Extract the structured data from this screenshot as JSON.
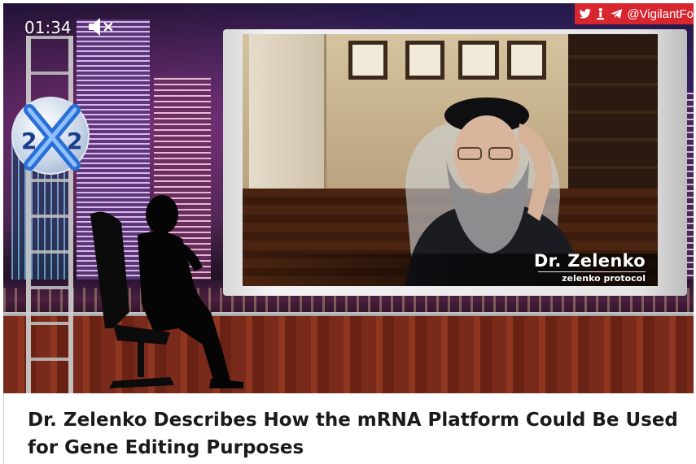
{
  "video": {
    "timestamp": "01:34",
    "mute_icon": "speaker-muted-icon",
    "social": {
      "icons": [
        "twitter-icon",
        "rumble-icon",
        "telegram-icon"
      ],
      "handle": "@VigilantFo"
    },
    "channel_logo": "2x2-logo",
    "lower_third": {
      "name": "Dr. Zelenko",
      "subtitle": "zelenko protocol"
    }
  },
  "caption": {
    "title": "Dr. Zelenko Describes How the mRNA Platform Could Be Used for Gene Editing Purposes"
  },
  "colors": {
    "social_bar": "#d8262f",
    "caption_text": "#1a1a1a",
    "desk": "#7a2a1a"
  }
}
